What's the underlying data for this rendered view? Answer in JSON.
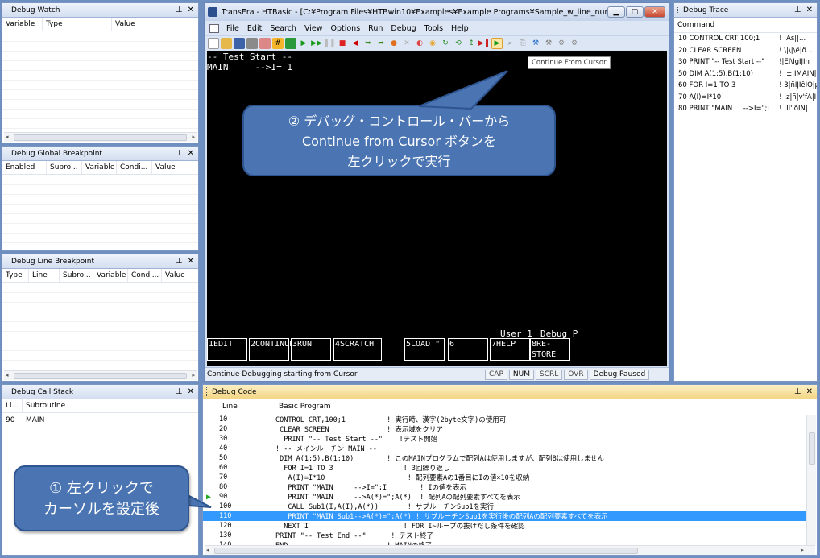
{
  "debug_watch": {
    "title": "Debug Watch",
    "columns": [
      "Variable",
      "Type",
      "Value"
    ]
  },
  "global_bp": {
    "title": "Debug Global Breakpoint",
    "columns": [
      "Enabled",
      "Subro...",
      "Variable",
      "Condi...",
      "Value"
    ]
  },
  "line_bp": {
    "title": "Debug Line Breakpoint",
    "columns": [
      "Type",
      "Line",
      "Subro...",
      "Variable",
      "Condi...",
      "Value"
    ]
  },
  "call_stack": {
    "title": "Debug Call Stack",
    "columns": [
      "Li...",
      "Subroutine"
    ],
    "rows": [
      [
        "90",
        "MAIN"
      ]
    ]
  },
  "trace": {
    "title": "Debug Trace",
    "column": "Command",
    "rows": [
      {
        "cmd": "10 CONTROL CRT,100;1",
        "val": "!  |Às||..."
      },
      {
        "cmd": "20 CLEAR SCREEN",
        "val": "!  \\|\\|\\ë|ö..."
      },
      {
        "cmd": "30 PRINT \"-- Test Start --\"",
        "val": "!|ÈÌ\\ÍgÌJIn"
      },
      {
        "cmd": "50 DIM A(1:5),B(1:10)",
        "val": "!  |±|ÌMAIN|v..."
      },
      {
        "cmd": "60 FOR I=1 TO 3",
        "val": "!  3|ñÌJIêÌÖ|µ"
      },
      {
        "cmd": "70 A(I)=I*10",
        "val": "!  |z|ñ|v'fA|Ì1Ö..."
      },
      {
        "cmd": "80 PRINT \"MAIN     -->I=\";I",
        "val": "!  |IÌ'lðÌN|"
      }
    ]
  },
  "window": {
    "title": "TransEra - HTBasic - [C:¥Program Files¥HTBwin10¥Examples¥Example Programs¥Sample_w_line_number.txt]",
    "menu": [
      "File",
      "Edit",
      "Search",
      "View",
      "Options",
      "Run",
      "Debug",
      "Tools",
      "Help"
    ],
    "tooltip": "Continue From Cursor",
    "screen": {
      "line1": "-- Test Start --",
      "line2": "MAIN     -->I= 1",
      "user": "User 1",
      "debug": "Debug P"
    },
    "softkeys": [
      {
        "n": "1",
        "t": "EDIT"
      },
      {
        "n": "2",
        "t": "CONTINUE"
      },
      {
        "n": "3",
        "t": "RUN"
      },
      {
        "n": "4",
        "t": "SCRATCH"
      },
      {
        "n": "5",
        "t": "LOAD \""
      },
      {
        "n": "6",
        "t": ""
      },
      {
        "n": "7",
        "t": "HELP"
      },
      {
        "n": "8",
        "t": "RE-STORE"
      }
    ],
    "status": {
      "text": "Continue Debugging starting from Cursor",
      "cap": "CAP",
      "num": "NUM",
      "scrl": "SCRL",
      "ovr": "OVR",
      "mode": "Debug Paused"
    }
  },
  "callout2": {
    "line1": "② デバッグ・コントロール・バーから",
    "line2": "Continue from Cursor ボタンを",
    "line3": "左クリックで実行"
  },
  "callout1": {
    "line1": "① 左クリックで",
    "line2": "カーソルを設定後"
  },
  "code": {
    "title": "Debug Code",
    "col_line": "Line",
    "col_prog": "Basic Program",
    "rows": [
      {
        "ln": "10",
        "cd": "CONTROL CRT,100;1          ! 実行時、漢字(2byte文字)の使用可"
      },
      {
        "ln": "20",
        "cd": " CLEAR SCREEN              ! 表示域をクリア"
      },
      {
        "ln": "30",
        "cd": "  PRINT \"-- Test Start --\"    !テスト開始"
      },
      {
        "ln": "40",
        "cd": "! -- メインルーチン MAIN --"
      },
      {
        "ln": "50",
        "cd": " DIM A(1:5),B(1:10)        ! このMAINプログラムで配列Aは使用しますが、配列Bは使用しません"
      },
      {
        "ln": "60",
        "cd": "  FOR I=1 TO 3                 ! 3回繰り返し"
      },
      {
        "ln": "70",
        "cd": "   A(I)=I*10                    ! 配列要素Aの1番目にIの値×10を収納"
      },
      {
        "ln": "80",
        "cd": "   PRINT \"MAIN     -->I=\";I        ! Iの値を表示"
      },
      {
        "ln": "90",
        "cd": "   PRINT \"MAIN     -->A(*)=\";A(*)  ! 配列Aの配列要素すべてを表示"
      },
      {
        "ln": "100",
        "cd": "   CALL Sub1(I,A(I),A(*))       ! サブルーチンSub1を実行"
      },
      {
        "ln": "110",
        "cd": "   PRINT \"MAIN Sub1-->A(*)=\";A(*) ! サブルーチンSub1を実行後の配列Aの配列要素すべてを表示"
      },
      {
        "ln": "120",
        "cd": "  NEXT I                       ! FOR I~ループの抜けだし条件を確認"
      },
      {
        "ln": "130",
        "cd": "PRINT \"-- Test End --\"      ! テスト終了"
      },
      {
        "ln": "140",
        "cd": "END                        ! MAINの終了"
      }
    ]
  },
  "colors": {
    "accent": "#3399ff",
    "callout": "#4a74b2",
    "arrow": "#22aa22"
  }
}
